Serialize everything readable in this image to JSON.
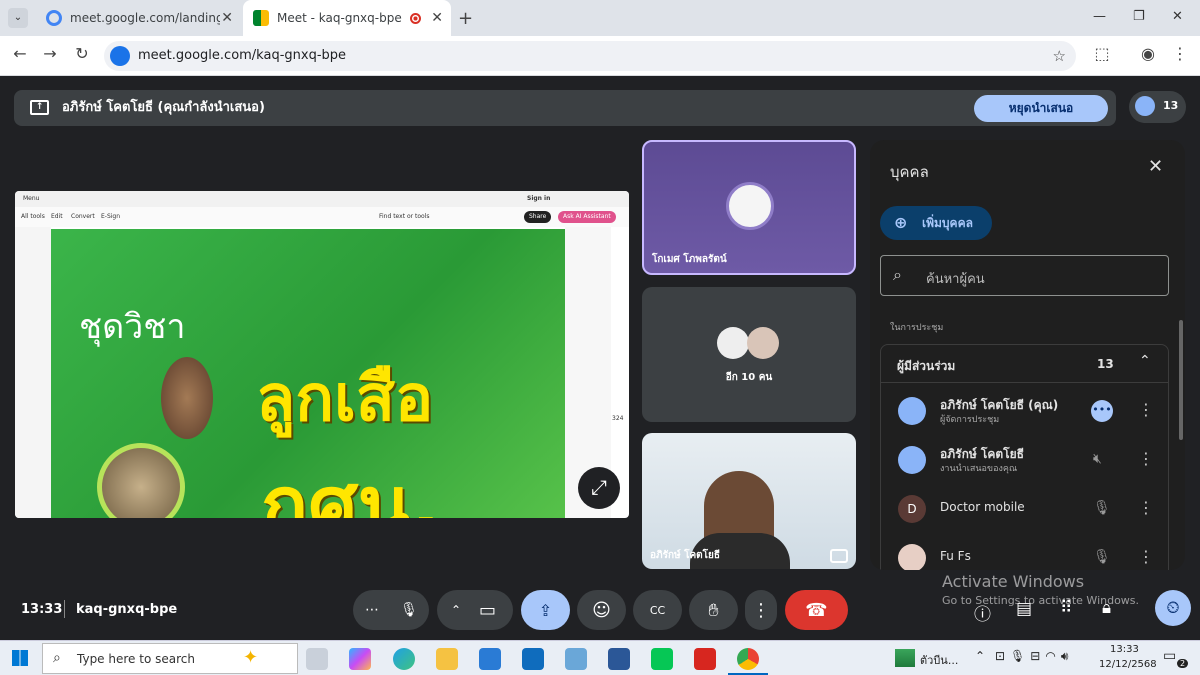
{
  "browser": {
    "tabs": [
      {
        "label": "meet.google.com/landing?hs=",
        "active": false
      },
      {
        "label": "Meet - kaq-gnxq-bpe",
        "active": true
      }
    ],
    "url": "meet.google.com/kaq-gnxq-bpe",
    "window_controls": [
      "—",
      "❐",
      "✕"
    ]
  },
  "meet": {
    "presenting_banner": "อภิรักษ์ โคตโยธี (คุณกำลังนำเสนอ)",
    "stop_presenting": "หยุดนำเสนอ",
    "participant_count": "13",
    "shared_screen": {
      "toolbar": [
        "All tools",
        "Edit",
        "Convert",
        "E-Sign"
      ],
      "find_text": "Find text or tools",
      "share": "Share",
      "ai_assistant": "Ask AI Assistant",
      "sign_in": "Sign in",
      "menu": "Menu",
      "slide_small_title": "ชุดวิชา",
      "slide_big_title": "ลูกเสือ",
      "slide_big_title2": "กศน.",
      "page_num": "324"
    },
    "tiles": [
      {
        "name": "โกเมศ โภพลรัตน์"
      },
      {
        "name": "อีก 10 คน"
      },
      {
        "name": "อภิรักษ์ โคตโยธี"
      }
    ],
    "panel": {
      "title": "บุคคล",
      "add_people": "เพิ่มบุคคล",
      "search_placeholder": "ค้นหาผู้คน",
      "section_label": "ในการประชุม",
      "group_label": "ผู้มีส่วนร่วม",
      "group_count": "13",
      "people": [
        {
          "name": "อภิรักษ์ โคตโยธี (คุณ)",
          "sub": "ผู้จัดการประชุม"
        },
        {
          "name": "อภิรักษ์ โคตโยธี",
          "sub": "งานนำเสนอของคุณ"
        },
        {
          "name": "Doctor mobile",
          "sub": "",
          "initial": "D"
        },
        {
          "name": "Fu Fs",
          "sub": ""
        }
      ]
    },
    "bottom": {
      "time": "13:33",
      "meeting_code": "kaq-gnxq-bpe"
    },
    "watermark": {
      "line1": "Activate Windows",
      "line2": "Go to Settings to activate Windows."
    }
  },
  "taskbar": {
    "search_placeholder": "Type here to search",
    "weather": "ตัวบีน...",
    "time": "13:33",
    "date": "12/12/2568",
    "notif": "2"
  },
  "colors": {
    "accent_blue": "#a8c7fa",
    "end_call": "#dc362e",
    "slide_green": "#2fa33a",
    "slide_yellow": "#ffe600"
  }
}
